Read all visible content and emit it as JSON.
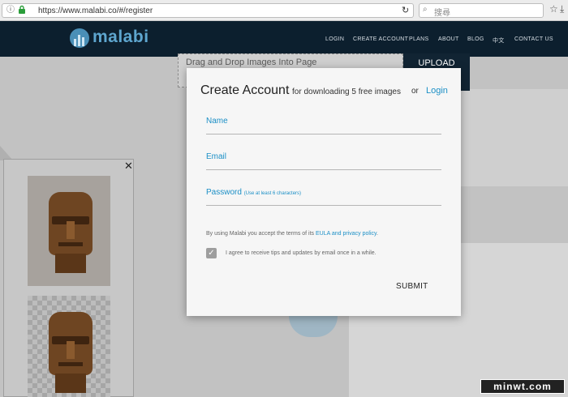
{
  "browser": {
    "url": "https://www.malabi.co/#/register",
    "search_placeholder": "搜尋"
  },
  "site": {
    "logo": "malabi",
    "nav": [
      "LOGIN",
      "CREATE ACCOUNT",
      "PLANS",
      "ABOUT",
      "BLOG",
      "中文",
      "CONTACT US"
    ]
  },
  "page": {
    "drop_text": "Drag and Drop Images Into Page",
    "upload_label": "UPLOAD"
  },
  "modal": {
    "title": "Create Account",
    "subtitle": "for downloading 5 free images",
    "or_text": "or",
    "login_link": "Login",
    "fields": [
      {
        "label": "Name",
        "hint": ""
      },
      {
        "label": "Email",
        "hint": ""
      },
      {
        "label": "Password",
        "hint": "(Use at least 6 characters)"
      }
    ],
    "terms_prefix": "By using Malabi you accept the terms of its",
    "terms_link": "EULA and privacy policy",
    "terms_suffix": ".",
    "checkbox_label": "I agree to receive tips and updates by email once in a while.",
    "checkbox_checked": true,
    "submit_label": "SUBMIT"
  },
  "watermark": "minwt.com",
  "colors": {
    "accent": "#1b8fc6",
    "header_bg": "#0c1f2e",
    "modal_bg": "#f6f6f6"
  },
  "icons": [
    "info-icon",
    "lock-icon",
    "reload-icon",
    "search-icon",
    "star-icon",
    "download-icon",
    "close-icon",
    "checkmark-icon"
  ]
}
